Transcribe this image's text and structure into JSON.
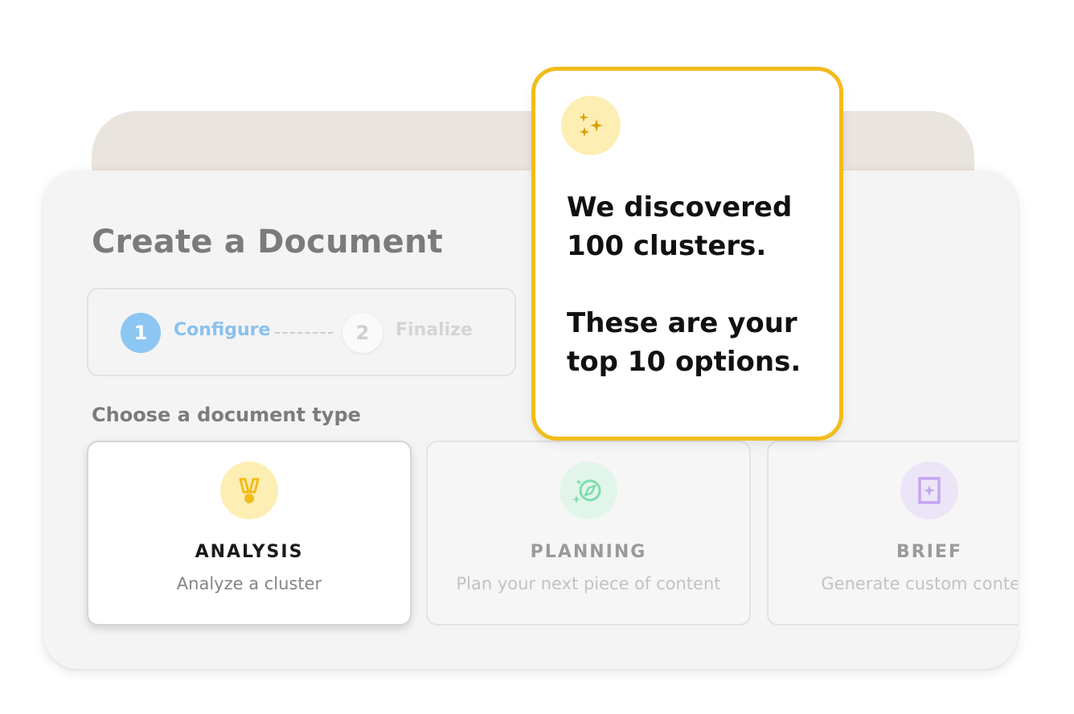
{
  "dialog": {
    "title": "Create a Document",
    "steps": [
      {
        "number": "1",
        "label": "Configure",
        "state": "active"
      },
      {
        "number": "2",
        "label": "Finalize",
        "state": "inactive"
      }
    ],
    "section_label": "Choose a document type",
    "document_types": [
      {
        "title": "ANALYSIS",
        "subtitle": "Analyze a cluster",
        "icon": "medal-icon",
        "selected": true
      },
      {
        "title": "PLANNING",
        "subtitle": "Plan your next piece of content",
        "icon": "compass-icon",
        "selected": false
      },
      {
        "title": "BRIEF",
        "subtitle": "Generate custom content",
        "icon": "sparkle-frame-icon",
        "selected": false
      }
    ]
  },
  "tooltip": {
    "icon": "sparkles-icon",
    "line1": "We discovered 100 clusters.",
    "line2": "These are your top 10 options."
  },
  "colors": {
    "accent_yellow": "#f2bc1b",
    "step_active": "#8cc6f2",
    "planning_green": "#7fdcae",
    "brief_purple": "#c5a6f0",
    "back_card": "#e9e4dd"
  }
}
